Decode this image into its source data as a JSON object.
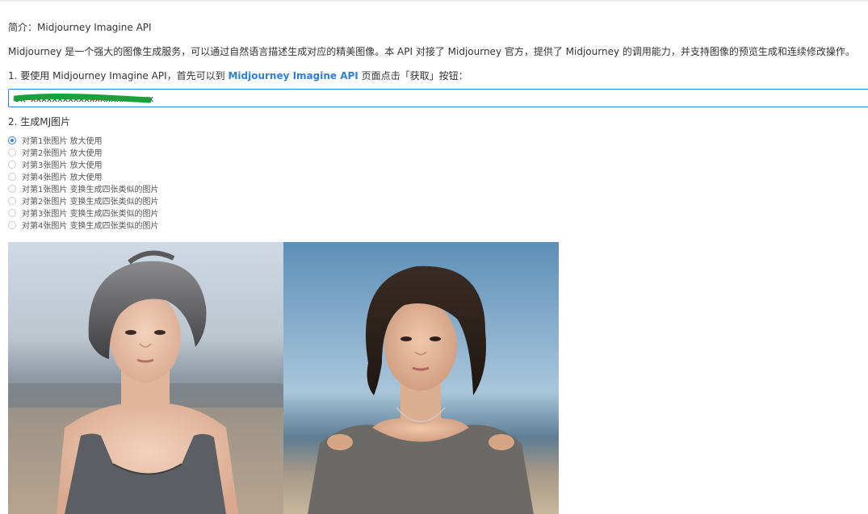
{
  "intro": {
    "label": "简介：",
    "name": "Midjourney Imagine API"
  },
  "description": "Midjourney 是一个强大的图像生成服务，可以通过自然语言描述生成对应的精美图像。本 API 对接了 Midjourney 官方，提供了 Midjourney 的调用能力，并支持图像的预览生成和连续修改操作。",
  "step1": {
    "prefix": "1. 要使用 Midjourney Imagine API，首先可以到 ",
    "link": "Midjourney Imagine API",
    "suffix": " 页面点击「获取」按钮："
  },
  "token_input": {
    "value": "sk-xxxxxxxxxxxxxxxxxxxxxxx",
    "redacted": true
  },
  "step2": {
    "title": "2. 生成MJ图片"
  },
  "options": [
    {
      "label": "对第1张图片 放大使用",
      "checked": true
    },
    {
      "label": "对第2张图片 放大使用",
      "checked": false
    },
    {
      "label": "对第3张图片 放大使用",
      "checked": false
    },
    {
      "label": "对第4张图片 放大使用",
      "checked": false
    },
    {
      "label": "对第1张图片 变换生成四张类似的图片",
      "checked": false
    },
    {
      "label": "对第2张图片 变换生成四张类似的图片",
      "checked": false
    },
    {
      "label": "对第3张图片 变换生成四张类似的图片",
      "checked": false
    },
    {
      "label": "对第4张图片 变换生成四张类似的图片",
      "checked": false
    }
  ],
  "colors": {
    "accent": "#2b88e6",
    "link": "#2f7fd8",
    "redaction": "#1aa23a"
  }
}
